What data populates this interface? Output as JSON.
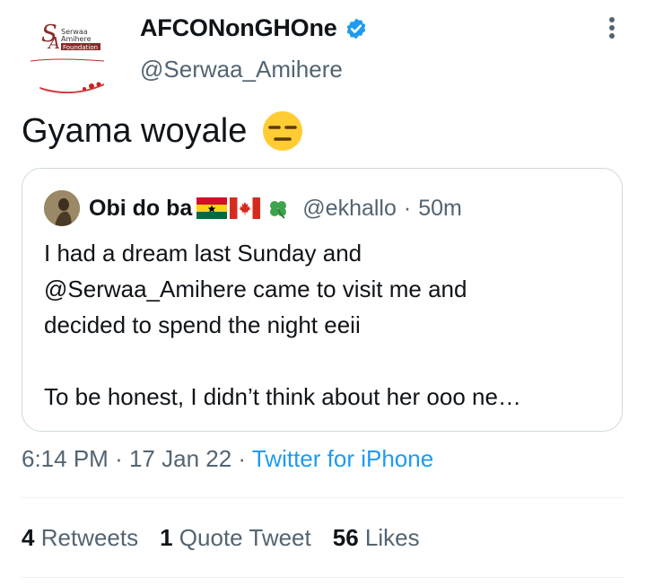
{
  "author": {
    "display_name": "AFCONonGHOne",
    "handle": "@Serwaa_Amihere",
    "verified": true,
    "avatar_logo_text": "Serwaa Amihere Foundation"
  },
  "tweet": {
    "text": "Gyama woyale",
    "emoji": "expressionless-face"
  },
  "quoted": {
    "name": "Obi do ba",
    "flags": [
      "ghana-flag",
      "canada-flag",
      "shamrock"
    ],
    "handle": "@ekhallo",
    "separator": "·",
    "time": "50m",
    "lines": [
      "I had a dream last Sunday and",
      "@Serwaa_Amihere came to visit me and",
      "decided to spend the night eeii",
      "To be honest, I didn’t think about her ooo ne…"
    ]
  },
  "meta": {
    "time": "6:14 PM",
    "sep1": "·",
    "date": "17 Jan 22",
    "sep2": "·",
    "source": "Twitter for iPhone"
  },
  "stats": {
    "retweets_count": "4",
    "retweets_label": "Retweets",
    "quotes_count": "1",
    "quotes_label": "Quote Tweet",
    "likes_count": "56",
    "likes_label": "Likes"
  },
  "colors": {
    "link": "#1d9bf0",
    "secondary_text": "#536471",
    "border": "#cfd9de"
  }
}
